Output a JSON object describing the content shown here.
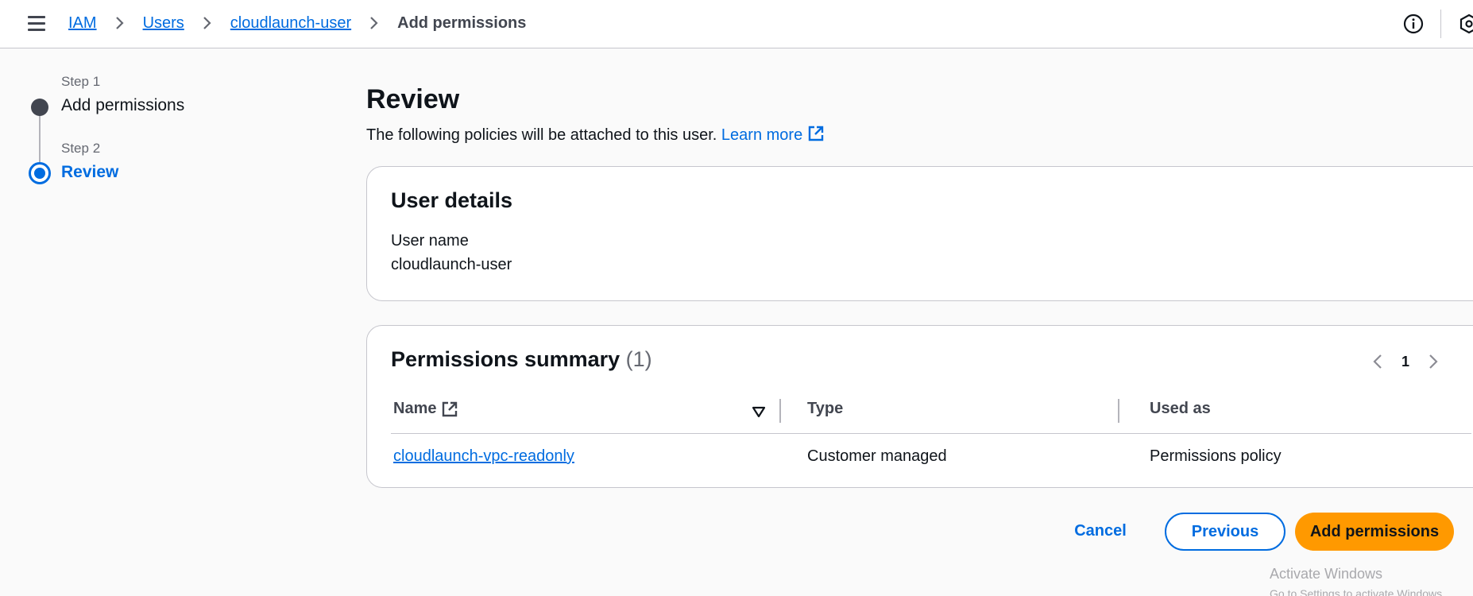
{
  "breadcrumb": {
    "items": [
      "IAM",
      "Users",
      "cloudlaunch-user"
    ],
    "current": "Add permissions"
  },
  "steps": [
    {
      "number": "Step 1",
      "label": "Add permissions"
    },
    {
      "number": "Step 2",
      "label": "Review"
    }
  ],
  "main": {
    "title": "Review",
    "description": "The following policies will be attached to this user.",
    "learn_more": "Learn more"
  },
  "user_details": {
    "title": "User details",
    "label": "User name",
    "value": "cloudlaunch-user"
  },
  "permissions": {
    "title": "Permissions summary",
    "count": "(1)",
    "page": "1",
    "columns": [
      "Name",
      "Type",
      "Used as"
    ],
    "rows": [
      {
        "name": "cloudlaunch-vpc-readonly",
        "type": "Customer managed",
        "used_as": "Permissions policy"
      }
    ]
  },
  "actions": {
    "cancel": "Cancel",
    "previous": "Previous",
    "add": "Add permissions"
  },
  "watermark": {
    "line1": "Activate Windows",
    "line2": "Go to Settings to activate Windows."
  },
  "colors": {
    "link": "#006ce0",
    "primary_button": "#ff9900",
    "step_completed": "#424650"
  }
}
